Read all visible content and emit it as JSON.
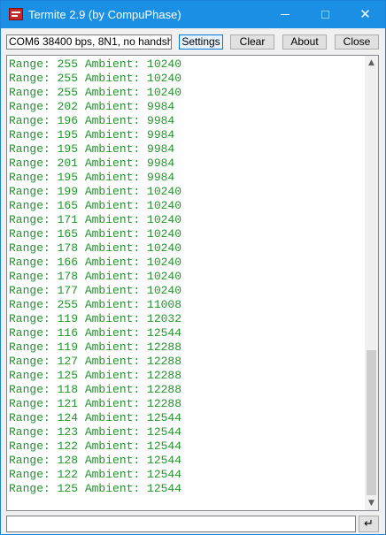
{
  "window": {
    "title": "Termite 2.9 (by CompuPhase)",
    "icons": {
      "app": "termite-app-icon",
      "minimize": "minimize-icon",
      "maximize": "maximize-icon",
      "close": "close-icon"
    },
    "close_glyph": "✕"
  },
  "toolbar": {
    "status": "COM6 38400 bps, 8N1, no handshake",
    "settings_label": "Settings",
    "clear_label": "Clear",
    "about_label": "About",
    "close_label": "Close"
  },
  "terminal": {
    "text_color": "#1e9628",
    "lines": [
      "Range: 255 Ambient: 10240",
      "Range: 255 Ambient: 10240",
      "Range: 255 Ambient: 10240",
      "Range: 202 Ambient: 9984",
      "Range: 196 Ambient: 9984",
      "Range: 195 Ambient: 9984",
      "Range: 195 Ambient: 9984",
      "Range: 201 Ambient: 9984",
      "Range: 195 Ambient: 9984",
      "Range: 199 Ambient: 10240",
      "Range: 165 Ambient: 10240",
      "Range: 171 Ambient: 10240",
      "Range: 165 Ambient: 10240",
      "Range: 178 Ambient: 10240",
      "Range: 166 Ambient: 10240",
      "Range: 178 Ambient: 10240",
      "Range: 177 Ambient: 10240",
      "Range: 255 Ambient: 11008",
      "Range: 119 Ambient: 12032",
      "Range: 116 Ambient: 12544",
      "Range: 119 Ambient: 12288",
      "Range: 127 Ambient: 12288",
      "Range: 125 Ambient: 12288",
      "Range: 118 Ambient: 12288",
      "Range: 121 Ambient: 12288",
      "Range: 124 Ambient: 12544",
      "Range: 123 Ambient: 12544",
      "Range: 122 Ambient: 12544",
      "Range: 128 Ambient: 12544",
      "Range: 122 Ambient: 12544",
      "Range: 125 Ambient: 12544"
    ],
    "scroll_up_glyph": "▲",
    "scroll_down_glyph": "▼"
  },
  "input": {
    "value": "",
    "send_glyph": "↵",
    "send_icon": "enter-icon"
  },
  "colors": {
    "titlebar": "#1a8fe3",
    "terminal_text": "#1e9628"
  }
}
